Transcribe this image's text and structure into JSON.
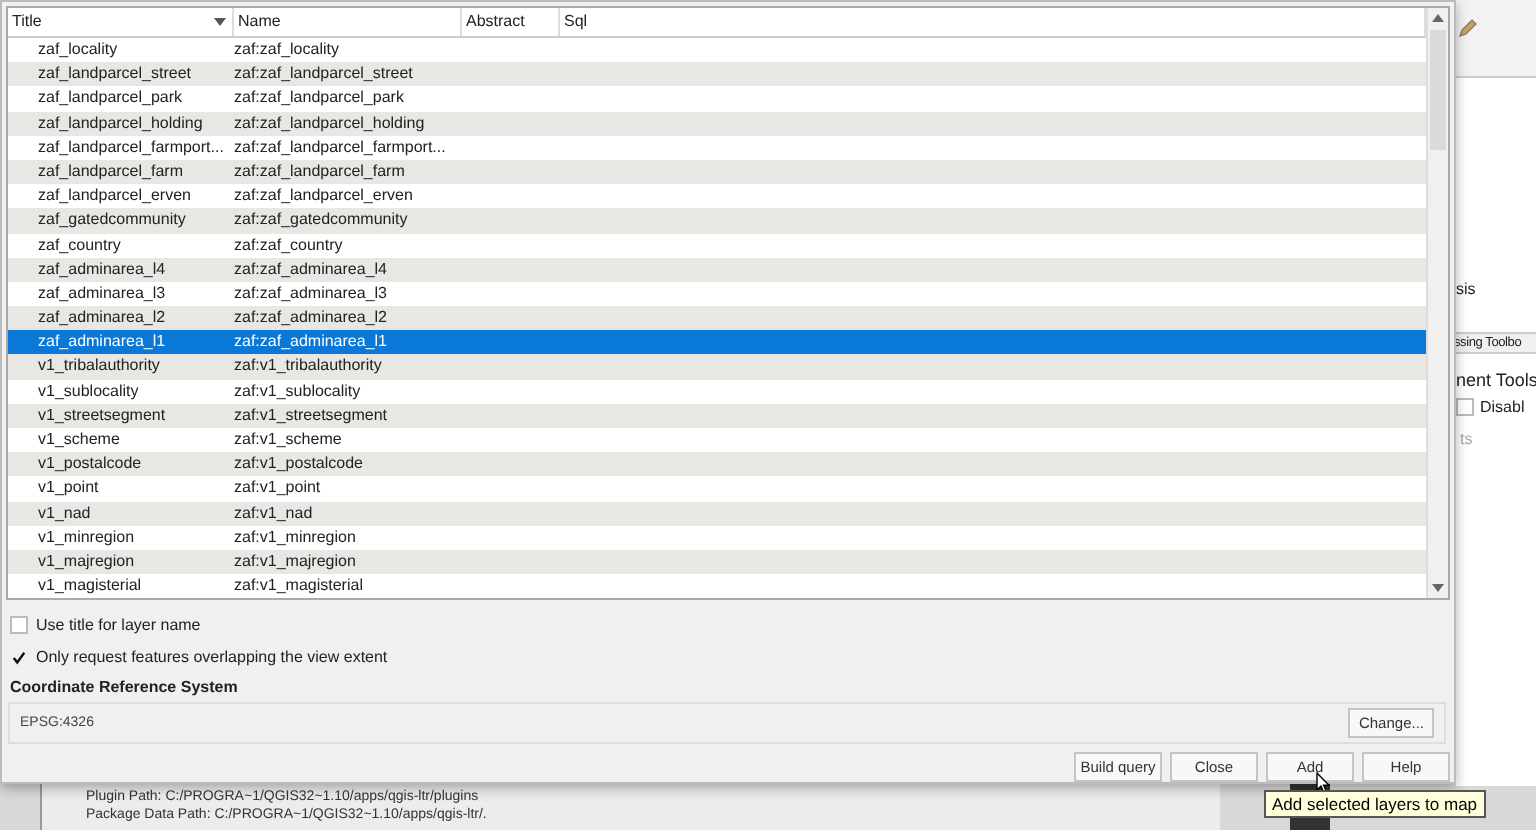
{
  "dialog": {
    "table": {
      "columns": [
        {
          "label": "Title",
          "sorted": true
        },
        {
          "label": "Name",
          "sorted": false
        },
        {
          "label": "Abstract",
          "sorted": false
        },
        {
          "label": "Sql",
          "sorted": false
        }
      ],
      "rows": [
        {
          "title": "zaf_locality",
          "name": "zaf:zaf_locality",
          "selected": false
        },
        {
          "title": "zaf_landparcel_street",
          "name": "zaf:zaf_landparcel_street",
          "selected": false
        },
        {
          "title": "zaf_landparcel_park",
          "name": "zaf:zaf_landparcel_park",
          "selected": false
        },
        {
          "title": "zaf_landparcel_holding",
          "name": "zaf:zaf_landparcel_holding",
          "selected": false
        },
        {
          "title": "zaf_landparcel_farmport...",
          "name": "zaf:zaf_landparcel_farmport...",
          "selected": false
        },
        {
          "title": "zaf_landparcel_farm",
          "name": "zaf:zaf_landparcel_farm",
          "selected": false
        },
        {
          "title": "zaf_landparcel_erven",
          "name": "zaf:zaf_landparcel_erven",
          "selected": false
        },
        {
          "title": "zaf_gatedcommunity",
          "name": "zaf:zaf_gatedcommunity",
          "selected": false
        },
        {
          "title": "zaf_country",
          "name": "zaf:zaf_country",
          "selected": false
        },
        {
          "title": "zaf_adminarea_l4",
          "name": "zaf:zaf_adminarea_l4",
          "selected": false
        },
        {
          "title": "zaf_adminarea_l3",
          "name": "zaf:zaf_adminarea_l3",
          "selected": false
        },
        {
          "title": "zaf_adminarea_l2",
          "name": "zaf:zaf_adminarea_l2",
          "selected": false
        },
        {
          "title": "zaf_adminarea_l1",
          "name": "zaf:zaf_adminarea_l1",
          "selected": true
        },
        {
          "title": "v1_tribalauthority",
          "name": "zaf:v1_tribalauthority",
          "selected": false
        },
        {
          "title": "v1_sublocality",
          "name": "zaf:v1_sublocality",
          "selected": false
        },
        {
          "title": "v1_streetsegment",
          "name": "zaf:v1_streetsegment",
          "selected": false
        },
        {
          "title": "v1_scheme",
          "name": "zaf:v1_scheme",
          "selected": false
        },
        {
          "title": "v1_postalcode",
          "name": "zaf:v1_postalcode",
          "selected": false
        },
        {
          "title": "v1_point",
          "name": "zaf:v1_point",
          "selected": false
        },
        {
          "title": "v1_nad",
          "name": "zaf:v1_nad",
          "selected": false
        },
        {
          "title": "v1_minregion",
          "name": "zaf:v1_minregion",
          "selected": false
        },
        {
          "title": "v1_majregion",
          "name": "zaf:v1_majregion",
          "selected": false
        },
        {
          "title": "v1_magisterial",
          "name": "zaf:v1_magisterial",
          "selected": false
        }
      ]
    },
    "options": [
      {
        "label": "Use title for layer name",
        "checked": false
      },
      {
        "label": "Only request features overlapping the view extent",
        "checked": true
      }
    ],
    "crs": {
      "heading": "Coordinate Reference System",
      "value": "EPSG:4326",
      "button": "Change..."
    },
    "buttons": [
      "Build query",
      "Close",
      "Add",
      "Help"
    ]
  },
  "tooltip": "Add selected layers to map",
  "background": {
    "side_texts": [
      "sis",
      "ssing Toolbo",
      "nent Tools"
    ],
    "disable_option": {
      "label": "Disabl",
      "checked": false
    },
    "side_hint": "ts",
    "log_lines": [
      "Plugin Path: C:/PROGRA~1/QGIS32~1.10/apps/qgis-ltr/plugins",
      "Package Data Path: C:/PROGRA~1/QGIS32~1.10/apps/qgis-ltr/."
    ]
  }
}
